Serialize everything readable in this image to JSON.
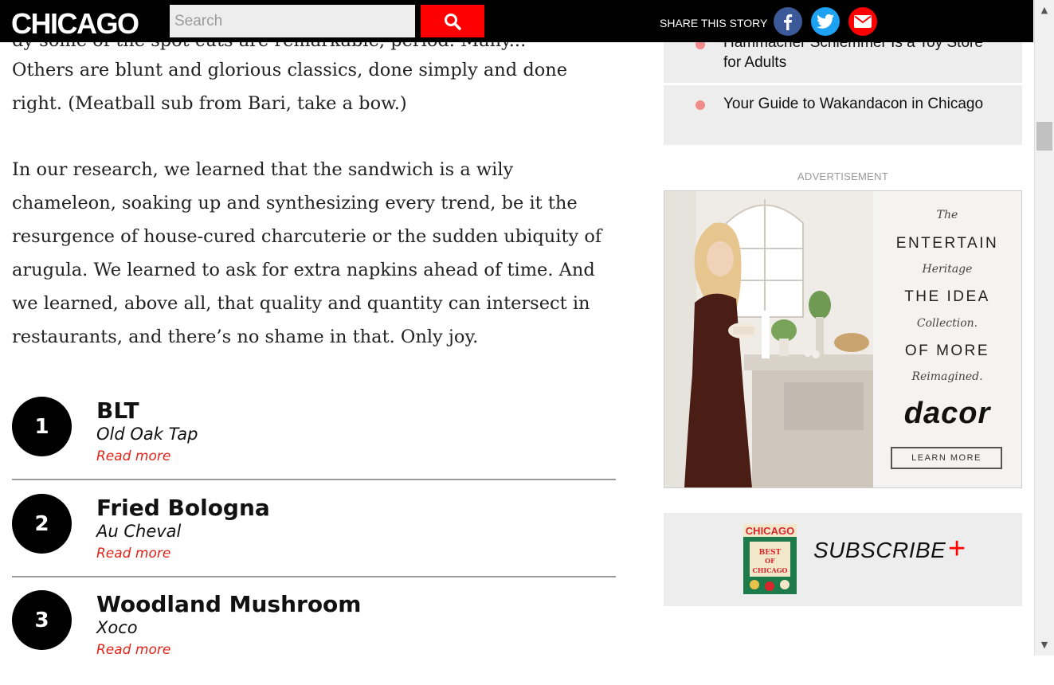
{
  "header": {
    "logo": "CHICAGO",
    "search_placeholder": "Search",
    "share_label": "SHARE THIS STORY",
    "share_icons": [
      "facebook-icon",
      "twitter-icon",
      "email-icon"
    ]
  },
  "article": {
    "partial_line": "dy some of the spot cuts are remarkable, period. Many...",
    "paragraph_1": [
      "Others are blunt and glorious classics, done simply and done",
      "right. (Meatball sub from Bari, take a bow.)"
    ],
    "paragraph_2": [
      "In our research, we learned that the sandwich is a wily",
      "chameleon, soaking up and synthesizing every trend, be it the",
      "resurgence of house-cured charcuterie or the sudden ubiquity of",
      "arugula. We learned to ask for extra napkins ahead of time. And",
      "we learned, above all, that quality and quantity can intersect in",
      "restaurants, and there’s no shame in that. Only joy."
    ],
    "ranked_items": [
      {
        "rank": "1",
        "name": "BLT",
        "restaurant": "Old Oak Tap",
        "link": "Read more"
      },
      {
        "rank": "2",
        "name": "Fried Bologna",
        "restaurant": "Au Cheval",
        "link": "Read more"
      },
      {
        "rank": "3",
        "name": "Woodland Mushroom",
        "restaurant": "Xoco",
        "link": "Read more"
      }
    ]
  },
  "sidebar": {
    "stories": [
      {
        "title": "Hammacher Schlemmer Is a Toy Store for Adults"
      },
      {
        "title": "Your Guide to Wakandacon in Chicago"
      }
    ],
    "ad_label": "ADVERTISEMENT",
    "ad": {
      "line_the": "The",
      "line_entertain": "ENTERTAIN",
      "line_heritage": "Heritage",
      "line_theidea": "THE IDEA",
      "line_collection": "Collection.",
      "line_ofmore": "OF MORE",
      "line_reimagined": "Reimagined.",
      "brand": "dacor",
      "cta": "LEARN MORE"
    },
    "subscribe": {
      "label": "SUBSCRIBE",
      "plus": "+",
      "cover_title": "CHICAGO",
      "cover_feature": "BEST OF CHICAGO"
    }
  },
  "colors": {
    "accent": "#ff0000",
    "link": "#e2231a",
    "facebook": "#3b5998",
    "twitter": "#1da1f2",
    "bullet": "#f28b8b",
    "panel": "#ededed"
  }
}
